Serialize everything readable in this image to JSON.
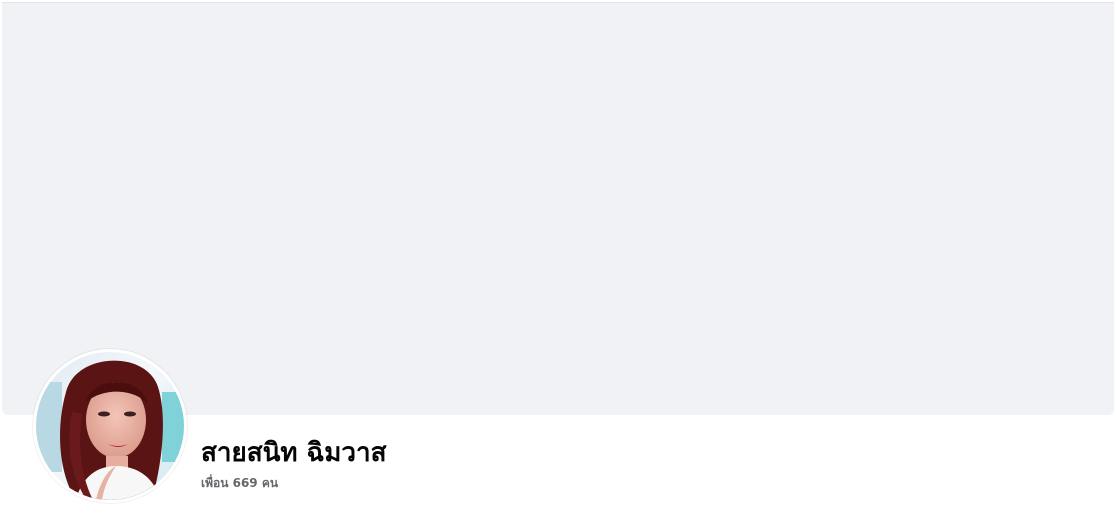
{
  "profile": {
    "name": "สายสนิท ฉิมวาส",
    "friends_label": "เพื่อน 669 คน"
  },
  "colors": {
    "cover": "#f0f2f5",
    "name_text": "#050505",
    "secondary_text": "#65676b"
  },
  "icons": {
    "avatar": "profile-photo"
  }
}
